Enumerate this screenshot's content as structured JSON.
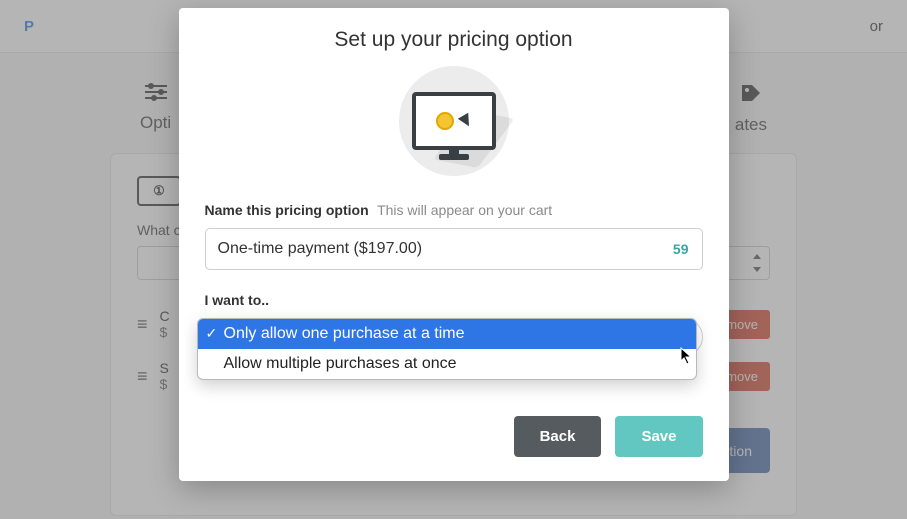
{
  "top": {
    "active_tab": "P",
    "right_tab": "or"
  },
  "subnav": {
    "left": "Opti",
    "left_icon": "sliders-icon",
    "right": "ates",
    "right_icon": "tag-icon"
  },
  "card": {
    "question": "What c",
    "rows": [
      {
        "line1": "C",
        "line2": "$",
        "remove": "move"
      },
      {
        "line1": "S",
        "line2": "$",
        "remove": "move"
      }
    ],
    "add_label": "Add another pricing option"
  },
  "modal": {
    "title": "Set up your pricing option",
    "name_label": "Name this pricing option",
    "name_hint": "This will appear on your cart",
    "name_value": "One-time payment ($197.00)",
    "name_chars_left": "59",
    "select_label": "I want to..",
    "options": [
      "Only allow one purchase at a time",
      "Allow multiple purchases at once"
    ],
    "selected_index": 0,
    "back": "Back",
    "save": "Save"
  }
}
